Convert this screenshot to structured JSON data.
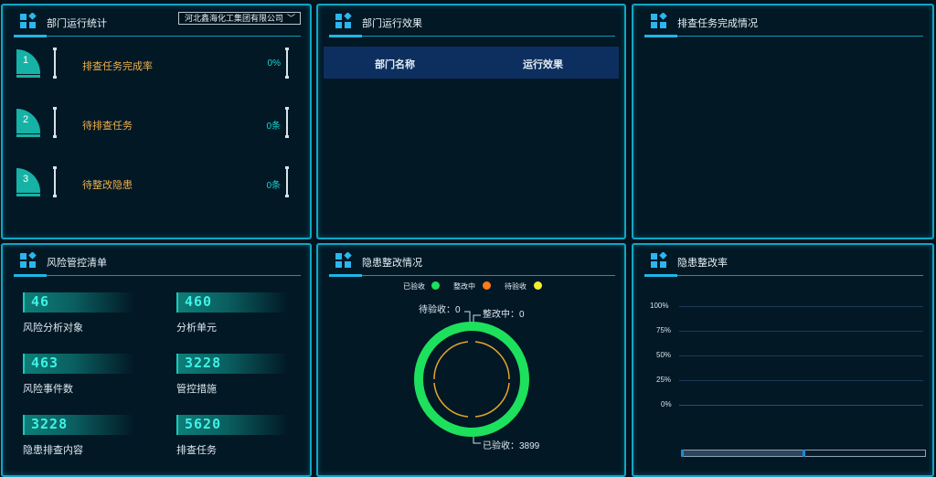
{
  "panels": {
    "dept_stats": {
      "title": "部门运行统计",
      "dropdown_value": "河北鑫海化工集团有限公司",
      "rows": [
        {
          "num": "1",
          "label": "排查任务完成率",
          "value": "0%"
        },
        {
          "num": "2",
          "label": "待排查任务",
          "value": "0条"
        },
        {
          "num": "3",
          "label": "待整改隐患",
          "value": "0条"
        }
      ]
    },
    "dept_effect": {
      "title": "部门运行效果",
      "columns": [
        "部门名称",
        "运行效果"
      ]
    },
    "task_completion": {
      "title": "排查任务完成情况"
    },
    "risk_list": {
      "title": "风险管控清单",
      "items": [
        {
          "value": "46",
          "label": "风险分析对象"
        },
        {
          "value": "460",
          "label": "分析单元"
        },
        {
          "value": "463",
          "label": "风险事件数"
        },
        {
          "value": "3228",
          "label": "管控措施"
        },
        {
          "value": "3228",
          "label": "隐患排查内容"
        },
        {
          "value": "5620",
          "label": "排查任务"
        }
      ]
    },
    "hazard_rectify": {
      "title": "隐患整改情况",
      "legend": [
        {
          "label": "已验收",
          "color": "#1de05c"
        },
        {
          "label": "整改中",
          "color": "#ff7a1a"
        },
        {
          "label": "待验收",
          "color": "#f2ee32"
        }
      ],
      "annotations": {
        "pending": "待验收：0",
        "in_progress": "整改中：0",
        "accepted": "已验收：3899"
      },
      "chart_data": {
        "type": "pie",
        "categories": [
          "已验收",
          "整改中",
          "待验收"
        ],
        "values": [
          3899,
          0,
          0
        ]
      }
    },
    "hazard_rate": {
      "title": "隐患整改率",
      "chart_data": {
        "type": "bar",
        "y_ticks": [
          "100%",
          "75%",
          "50%",
          "25%",
          "0%"
        ],
        "ylim": [
          0,
          100
        ],
        "categories": [],
        "values": []
      }
    }
  },
  "colors": {
    "border": "#0fa6c4",
    "accent_green": "#1de05c",
    "label_orange": "#f0b04c",
    "value_cyan": "#19d6d6"
  }
}
